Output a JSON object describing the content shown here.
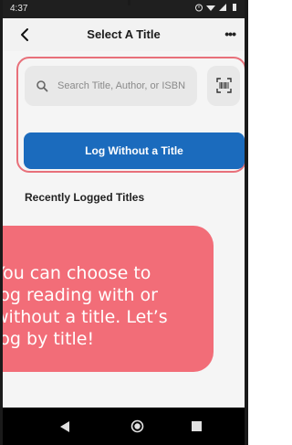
{
  "status_bar": {
    "time": "4:37",
    "icons": [
      "alarm-icon",
      "wifi-icon",
      "signal-icon",
      "battery-icon"
    ]
  },
  "header": {
    "title": "Select A Title",
    "back_icon": "chevron-left-icon",
    "more_label": "•••"
  },
  "search": {
    "placeholder": "Search Title, Author, or ISBN",
    "value": "",
    "scan_icon": "barcode-scan-icon"
  },
  "log_button": {
    "label": "Log Without a Title"
  },
  "recent": {
    "heading": "Recently Logged Titles"
  },
  "tooltip": {
    "lines": [
      "You can choose to",
      "log reading with or",
      "without a title. Let’s",
      "log by title!"
    ]
  },
  "nav_bar": {
    "icons": [
      "back-triangle-icon",
      "home-circle-icon",
      "recents-square-icon"
    ]
  },
  "colors": {
    "accent_blue": "#1b6bbd",
    "highlight_red": "#e8707a",
    "tooltip_bg": "#f26d78"
  }
}
